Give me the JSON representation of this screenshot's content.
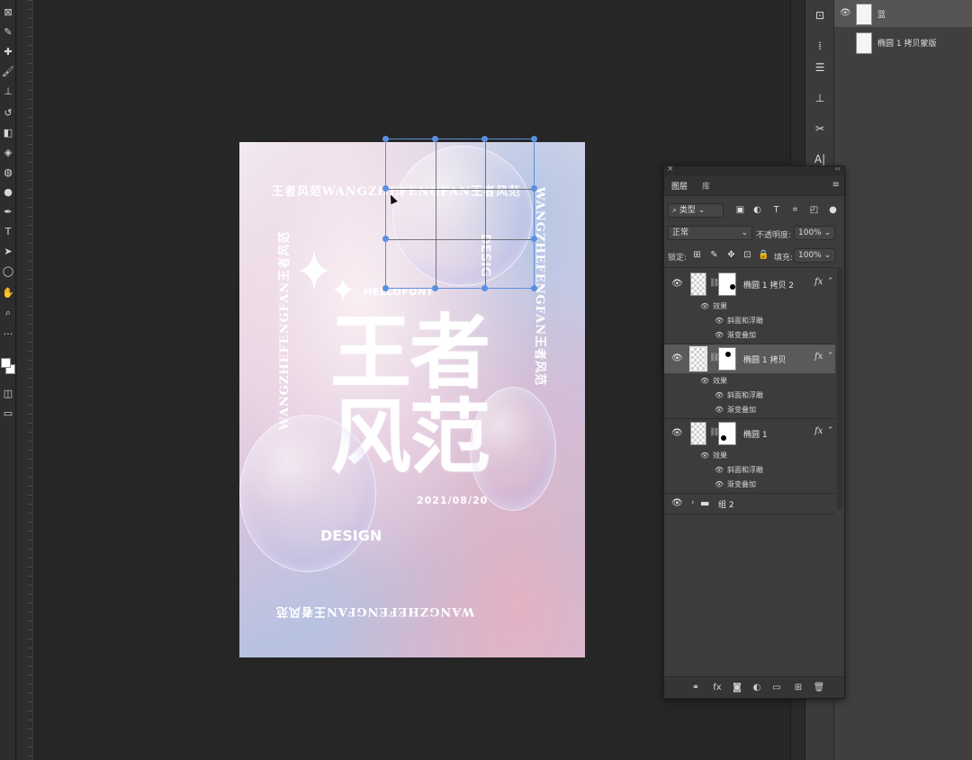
{
  "toolbar": {
    "tools": [
      {
        "name": "frame-tool-icon",
        "glyph": "⊠"
      },
      {
        "name": "eyedropper-icon",
        "glyph": "✎"
      },
      {
        "name": "healing-brush-icon",
        "glyph": "✚"
      },
      {
        "name": "brush-icon",
        "glyph": "🖌"
      },
      {
        "name": "stamp-icon",
        "glyph": "⊥"
      },
      {
        "name": "history-brush-icon",
        "glyph": "↺"
      },
      {
        "name": "eraser-icon",
        "glyph": "◧"
      },
      {
        "name": "paint-bucket-icon",
        "glyph": "◈"
      },
      {
        "name": "blur-icon",
        "glyph": "◍"
      },
      {
        "name": "dodge-icon",
        "glyph": "●"
      },
      {
        "name": "pen-icon",
        "glyph": "✒"
      },
      {
        "name": "type-tool-icon",
        "glyph": "T"
      },
      {
        "name": "path-select-icon",
        "glyph": "➤"
      },
      {
        "name": "ellipse-tool-icon",
        "glyph": "◯"
      },
      {
        "name": "hand-tool-icon",
        "glyph": "✋"
      },
      {
        "name": "zoom-tool-icon",
        "glyph": "⌕"
      },
      {
        "name": "more-tools-icon",
        "glyph": "···"
      }
    ]
  },
  "poster": {
    "title_line1": "王者",
    "title_line2": "风范",
    "frame_top": "王者风范WANGZHEFENGFAN王者风范",
    "frame_side_right": "WANGZHEFENGFAN王者风范",
    "frame_side_left": "WANGZHEFENGFAN王者风范",
    "frame_bottom": "WANGZHEFENGFAN王者风范",
    "hellofont": "HELLOFONT",
    "date": "2021/08/20",
    "design_main": "DESIGN",
    "design_top": "DESIG"
  },
  "top_layers": {
    "row1": "蓝",
    "row2": "椭圆 1 拷贝蒙版"
  },
  "layers_panel": {
    "tab_layers": "图层",
    "tab_library": "库",
    "filter_label": "类型",
    "blend_mode": "正常",
    "opacity_label": "不透明度:",
    "opacity_value": "100%",
    "lock_label": "锁定:",
    "fill_label": "填充:",
    "fill_value": "100%",
    "layers": [
      {
        "name": "椭圆 1 拷贝 2",
        "fx": "fx",
        "effects_label": "效果",
        "effect1": "斜面和浮雕",
        "effect2": "渐变叠加"
      },
      {
        "name": "椭圆 1 拷贝",
        "fx": "fx",
        "effects_label": "效果",
        "effect1": "斜面和浮雕",
        "effect2": "渐变叠加"
      },
      {
        "name": "椭圆 1",
        "fx": "fx",
        "effects_label": "效果",
        "effect1": "斜面和浮雕",
        "effect2": "渐变叠加"
      }
    ],
    "group_name": "组 2"
  }
}
